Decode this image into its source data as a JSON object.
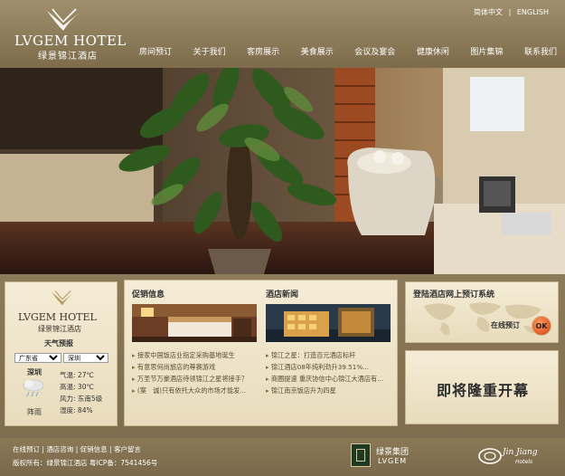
{
  "header": {
    "logo_en": "LVGEM HOTEL",
    "logo_cn": "绿景锦江酒店",
    "lang_cn": "简体中文",
    "lang_sep": "|",
    "lang_en": "ENGLISH"
  },
  "nav": [
    "房间预订",
    "关于我们",
    "客房展示",
    "美食展示",
    "会议及宴会",
    "健康休闲",
    "图片集锦",
    "联系我们"
  ],
  "weather": {
    "logo_en": "LVGEM HOTEL",
    "logo_cn": "绿景锦江酒店",
    "title": "天气预报",
    "province": "广东省",
    "city": "深圳",
    "today_city": "深圳",
    "today_cond": "阵雨",
    "temp_label": "气温:",
    "temp": "27℃",
    "high_label": "高温:",
    "high": "30℃",
    "wind_label": "风力:",
    "wind": "东南5级",
    "humidity_label": "湿度:",
    "humidity": "84%"
  },
  "promo": {
    "title": "促销信息",
    "items": [
      "接家中国饭店业指定采购基地诞生",
      "有意思何尚旅店的尊赛游戏",
      "万圣节万豪酒店待领锦江之星将接手？",
      "(案　诚)只有依托大众的市场才能发..."
    ]
  },
  "hotel_news": {
    "title": "酒店新闻",
    "items": [
      "锦江之星：打造百元酒店标杆",
      "锦江酒店08年纯利劲升39.51%...",
      "商圈提速 重庆协信中心锦江大酒店有...",
      "锦江南京饭店升为四星"
    ]
  },
  "login": {
    "title": "登陆酒店网上预订系统",
    "label": "在线预订",
    "ok": "OK"
  },
  "opening": {
    "text": "即将隆重开幕"
  },
  "footer": {
    "links": [
      "在线预订",
      "酒店咨询",
      "促销信息",
      "客户留言"
    ],
    "sep": "|",
    "copyright": "版权所有：绿景锦江酒店  粤ICP备：7541456号",
    "group_cn": "绿景集团",
    "group_en": "LVGEM",
    "jinjiang": "Jin Jiang",
    "jinjiang_sub": "Hotels"
  },
  "colors": {
    "accent": "#8b7a58",
    "ok_button": "#e8632a",
    "panel": "#f4ecd6"
  }
}
